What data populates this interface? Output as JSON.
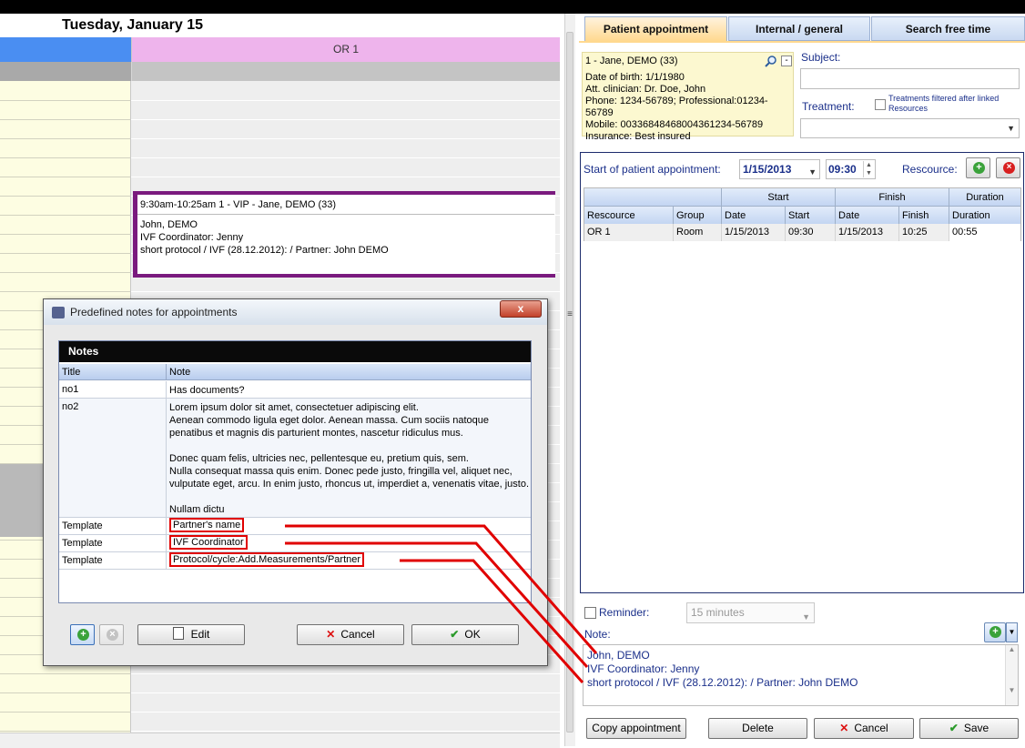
{
  "calendar": {
    "date_title": "Tuesday, January 15",
    "room_column": "OR 1",
    "appointment": {
      "title": "9:30am-10:25am 1 - VIP - Jane, DEMO (33)",
      "body": "John, DEMO\nIVF Coordinator: Jenny\nshort protocol / IVF (28.12.2012): / Partner: John DEMO"
    },
    "colors": {
      "room_header": "#eeb4ec",
      "time_header": "#4a8ef2",
      "appointment_border": "#7a1a7e"
    }
  },
  "tabs": [
    {
      "label": "Patient appointment",
      "active": true
    },
    {
      "label": "Internal / general",
      "active": false
    },
    {
      "label": "Search free time",
      "active": false
    }
  ],
  "patient": {
    "name": "1 - Jane, DEMO (33)",
    "details": "Date of birth: 1/1/1980\nAtt. clinician: Dr. Doe, John\nPhone: 1234-56789; Professional:01234-56789\nMobile: 00336848468004361234-56789\nInsurance: Best insured",
    "minus_label": "-",
    "search_icon": "magnifier-icon"
  },
  "form": {
    "subject_label": "Subject:",
    "subject_value": "",
    "treatment_label": "Treatment:",
    "treatment_filter_label": "Treatments filtered after linked Resources",
    "treatment_value": "",
    "start_label": "Start of patient appointment:",
    "start_date": "1/15/2013",
    "start_time": "09:30",
    "rescource_label": "Rescource:"
  },
  "resources_grid": {
    "group_headers": [
      "Start",
      "Finish",
      "Duration"
    ],
    "columns": [
      "Rescource",
      "Group",
      "Date",
      "Start",
      "Date",
      "Finish",
      "Duration"
    ],
    "rows": [
      [
        "OR 1",
        "Room",
        "1/15/2013",
        "09:30",
        "1/15/2013",
        "10:25",
        "00:55"
      ]
    ]
  },
  "reminder": {
    "label": "Reminder:",
    "value": "15 minutes",
    "checked": false
  },
  "note": {
    "label": "Note:",
    "text": "John, DEMO\nIVF Coordinator: Jenny\nshort protocol / IVF (28.12.2012): / Partner: John DEMO"
  },
  "buttons": {
    "copy": "Copy appointment",
    "delete": "Delete",
    "cancel": "Cancel",
    "save": "Save"
  },
  "dialog": {
    "title": "Predefined notes for appointments",
    "close": "x",
    "section": "Notes",
    "col_title": "Title",
    "col_note": "Note",
    "rows": [
      {
        "title": "no1",
        "note": "Has documents?"
      },
      {
        "title": "no2",
        "note": "Lorem ipsum dolor sit amet, consectetuer adipiscing elit.\nAenean commodo ligula eget dolor. Aenean massa. Cum sociis natoque penatibus et magnis dis parturient montes, nascetur ridiculus mus.\n\nDonec quam felis, ultricies nec, pellentesque eu, pretium quis, sem.\nNulla consequat massa quis enim. Donec pede justo, fringilla vel, aliquet nec, vulputate eget, arcu. In enim justo, rhoncus ut, imperdiet a, venenatis vitae, justo.\n\nNullam dictu"
      },
      {
        "title": "Template",
        "note": "Partner's name"
      },
      {
        "title": "Template",
        "note": "IVF Coordinator"
      },
      {
        "title": "Template",
        "note": "Protocol/cycle:Add.Measurements/Partner"
      }
    ],
    "edit": "Edit",
    "cancel": "Cancel",
    "ok": "OK"
  },
  "colors": {
    "highlight_red": "#e00000",
    "tab_active": "#ffd98f",
    "label_blue": "#1a2f8a"
  }
}
